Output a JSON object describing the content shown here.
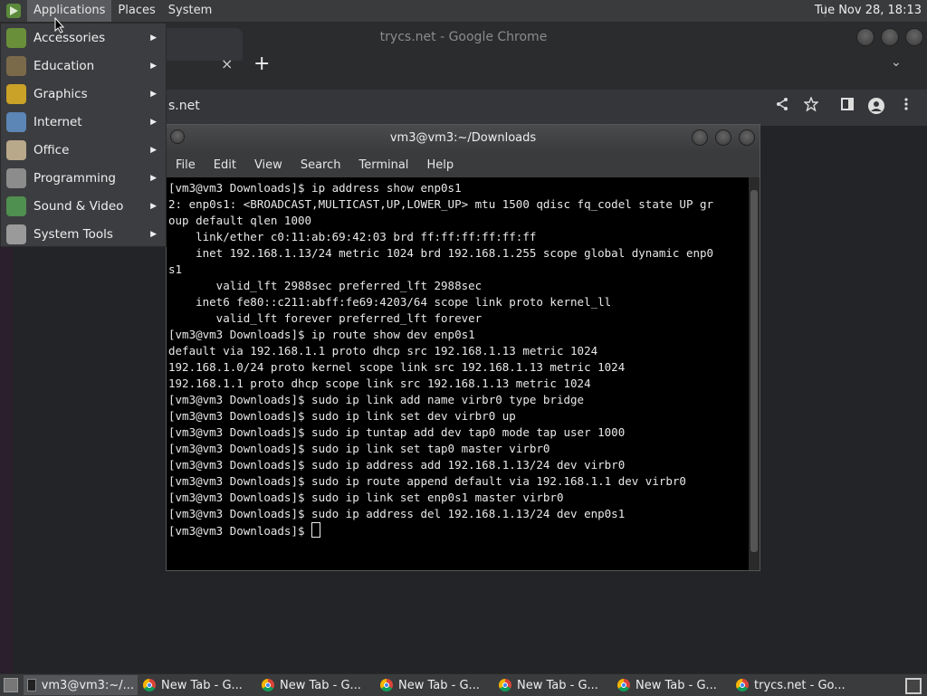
{
  "top_panel": {
    "menus": [
      "Applications",
      "Places",
      "System"
    ],
    "clock": "Tue Nov 28, 18:13"
  },
  "chrome": {
    "title": "trycs.net - Google Chrome",
    "tab_close": "×",
    "new_tab": "+",
    "tab_search": "⌄",
    "omnibox_text": "s.net"
  },
  "terminal": {
    "title": "vm3@vm3:~/Downloads",
    "menus": [
      "File",
      "Edit",
      "View",
      "Search",
      "Terminal",
      "Help"
    ],
    "lines": [
      "[vm3@vm3 Downloads]$ ip address show enp0s1",
      "2: enp0s1: <BROADCAST,MULTICAST,UP,LOWER_UP> mtu 1500 qdisc fq_codel state UP gr",
      "oup default qlen 1000",
      "    link/ether c0:11:ab:69:42:03 brd ff:ff:ff:ff:ff:ff",
      "    inet 192.168.1.13/24 metric 1024 brd 192.168.1.255 scope global dynamic enp0",
      "s1",
      "       valid_lft 2988sec preferred_lft 2988sec",
      "    inet6 fe80::c211:abff:fe69:4203/64 scope link proto kernel_ll",
      "       valid_lft forever preferred_lft forever",
      "[vm3@vm3 Downloads]$ ip route show dev enp0s1",
      "default via 192.168.1.1 proto dhcp src 192.168.1.13 metric 1024",
      "192.168.1.0/24 proto kernel scope link src 192.168.1.13 metric 1024",
      "192.168.1.1 proto dhcp scope link src 192.168.1.13 metric 1024",
      "[vm3@vm3 Downloads]$ sudo ip link add name virbr0 type bridge",
      "[vm3@vm3 Downloads]$ sudo ip link set dev virbr0 up",
      "[vm3@vm3 Downloads]$ sudo ip tuntap add dev tap0 mode tap user 1000",
      "[vm3@vm3 Downloads]$ sudo ip link set tap0 master virbr0",
      "[vm3@vm3 Downloads]$ sudo ip address add 192.168.1.13/24 dev virbr0",
      "[vm3@vm3 Downloads]$ sudo ip route append default via 192.168.1.1 dev virbr0",
      "[vm3@vm3 Downloads]$ sudo ip link set enp0s1 master virbr0",
      "[vm3@vm3 Downloads]$ sudo ip address del 192.168.1.13/24 dev enp0s1"
    ],
    "prompt": "[vm3@vm3 Downloads]$ "
  },
  "app_menu": {
    "items": [
      {
        "label": "Accessories",
        "icon": "accessories-icon",
        "color": "#6a8f3a"
      },
      {
        "label": "Education",
        "icon": "education-icon",
        "color": "#7b6a4a"
      },
      {
        "label": "Graphics",
        "icon": "graphics-icon",
        "color": "#c9a227"
      },
      {
        "label": "Internet",
        "icon": "internet-icon",
        "color": "#5b86b5"
      },
      {
        "label": "Office",
        "icon": "office-icon",
        "color": "#b8a98a"
      },
      {
        "label": "Programming",
        "icon": "programming-icon",
        "color": "#8c8c8c"
      },
      {
        "label": "Sound & Video",
        "icon": "sound-video-icon",
        "color": "#4f8f4f"
      },
      {
        "label": "System Tools",
        "icon": "system-tools-icon",
        "color": "#9a9a9a"
      }
    ]
  },
  "taskbar": {
    "tasks": [
      {
        "label": "vm3@vm3:~/...",
        "type": "terminal",
        "active": true
      },
      {
        "label": "New Tab - G...",
        "type": "chrome",
        "active": false
      },
      {
        "label": "New Tab - G...",
        "type": "chrome",
        "active": false
      },
      {
        "label": "New Tab - G...",
        "type": "chrome",
        "active": false
      },
      {
        "label": "New Tab - G...",
        "type": "chrome",
        "active": false
      },
      {
        "label": "New Tab - G...",
        "type": "chrome",
        "active": false
      },
      {
        "label": "trycs.net - Go...",
        "type": "chrome",
        "active": false
      }
    ]
  }
}
